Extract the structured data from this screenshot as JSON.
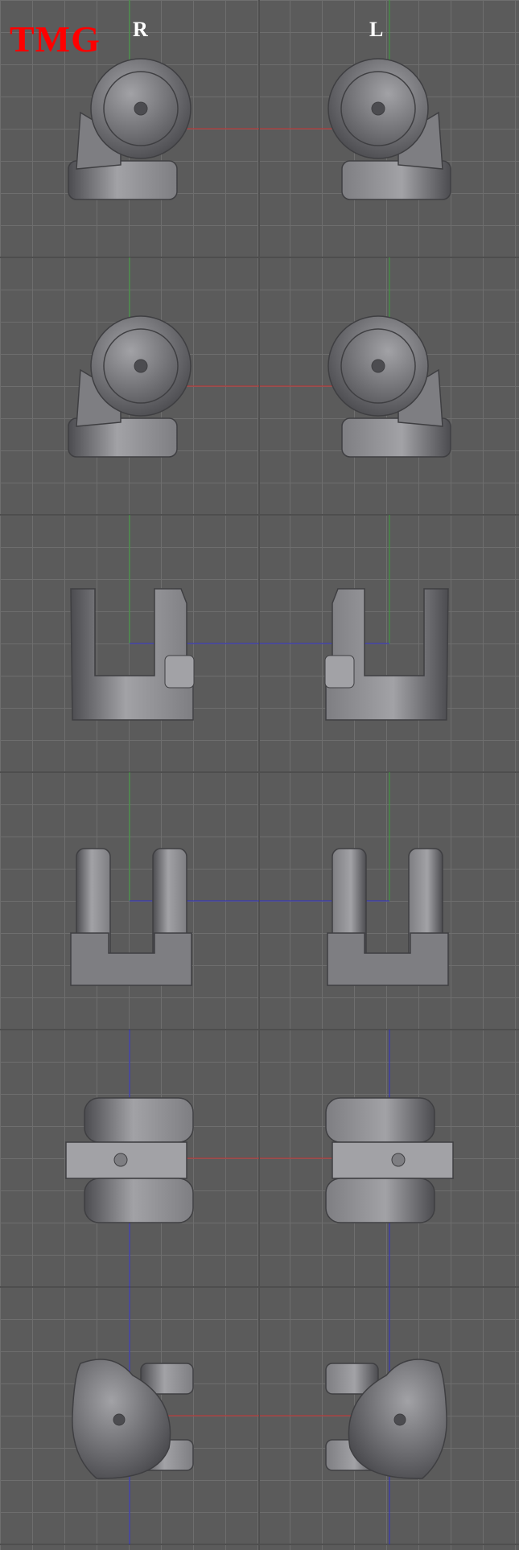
{
  "brand": {
    "logo_text": "TMG",
    "logo_color": "#ff0000"
  },
  "columns": {
    "right_label": "R",
    "left_label": "L"
  },
  "colors": {
    "background": "#5b5b5b",
    "grid_line": "#6e6e6e",
    "x_axis": "#c83030",
    "y_axis": "#3ca03c",
    "z_axis": "#2f2fc8",
    "part_base": "#7e7e82",
    "part_light": "#a2a2a6",
    "part_dark": "#4c4c50"
  },
  "views": [
    {
      "name": "front-view",
      "kind": "wheel-front"
    },
    {
      "name": "back-view",
      "kind": "wheel-front"
    },
    {
      "name": "top-view",
      "kind": "u-bracket-step"
    },
    {
      "name": "bottom-view",
      "kind": "u-bracket"
    },
    {
      "name": "side-view-a",
      "kind": "side-slab"
    },
    {
      "name": "side-view-b",
      "kind": "side-round"
    }
  ]
}
